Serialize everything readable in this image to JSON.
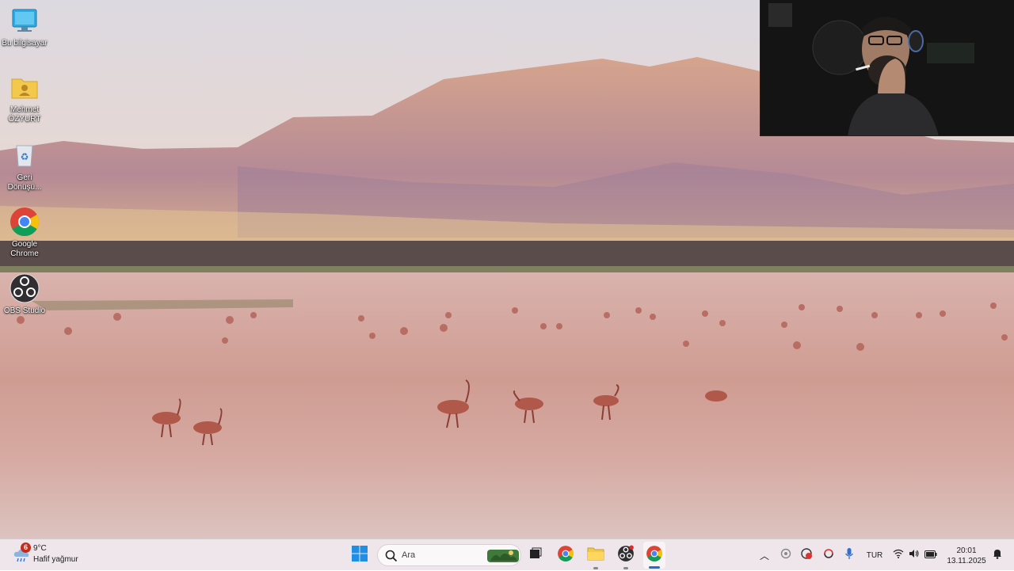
{
  "desktop": {
    "icons": [
      {
        "label": "Bu bilgisayar",
        "icon": "computer-icon"
      },
      {
        "label": "Mehmet ÖZYURT",
        "icon": "user-folder-icon"
      },
      {
        "label": "Geri Dönüşü...",
        "icon": "recycle-bin-icon"
      },
      {
        "label": "Google Chrome",
        "icon": "chrome-icon"
      },
      {
        "label": "OBS Studio",
        "icon": "obs-icon"
      }
    ]
  },
  "taskbar": {
    "weather": {
      "badge": "6",
      "temp": "9°C",
      "condition": "Hafif yağmur",
      "icon": "cloud-rain-icon"
    },
    "search_placeholder": "Ara",
    "apps": [
      "windows-start-icon",
      "search-icon",
      "widgets-icon",
      "task-view-icon",
      "chrome-icon",
      "file-explorer-icon",
      "obs-icon",
      "chrome-icon"
    ],
    "tray": {
      "language": "TUR",
      "time": "20:01",
      "date": "13.11.2025"
    },
    "colors": {
      "accent": "#1a6fd0",
      "notification": "#c42b1c"
    }
  }
}
